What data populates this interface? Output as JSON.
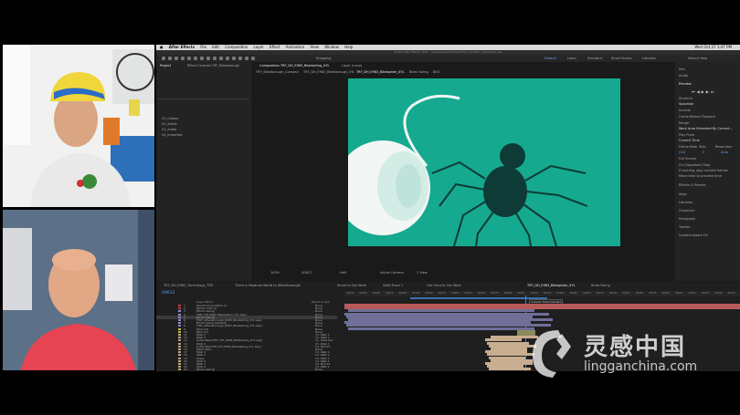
{
  "menubar": {
    "app": "After Effects",
    "items": [
      "File",
      "Edit",
      "Composition",
      "Layer",
      "Effect",
      "Animation",
      "View",
      "Window",
      "Help"
    ],
    "clock": "Wed Oct 27  1:47 PM"
  },
  "titlebar": {
    "title": "Adobe After Effects 2022 - /Users/Kaye/Dropbox/THV_Animation_Workshop.aep"
  },
  "toolbar": {
    "snapping": "Snapping",
    "workspaces": [
      "Default",
      "Learn",
      "Standard",
      "Small Screen",
      "Libraries"
    ],
    "search": "Search Help"
  },
  "project": {
    "tabs": [
      "Project",
      "Effect Controls TRF_Bikeborough"
    ],
    "files": [
      "01_Comps",
      "02_Solids",
      "03_Audio",
      "04_Imported"
    ]
  },
  "comp": {
    "header": "Composition TRF_DH_E983_Bikeballing_XYL",
    "layer_tab": "Layer (none)",
    "tabs": [
      "TRF_Bikeborough_Comped",
      "TRF_DH_E983_Bikeborough_XYL",
      "TRF_DH_E983_Bikespider_XYL",
      "Bikes Swing",
      "BKG"
    ],
    "footer": {
      "zoom": "100%",
      "time": "00612",
      "res": "Half",
      "camera": "Active Camera",
      "views": "1 View"
    }
  },
  "rightpanel": {
    "sections": [
      "Info",
      "Audio",
      "Preview",
      "Shortcut",
      "Include",
      "Cache Before Playback",
      "Range",
      "Work Area Extended By Current...",
      "Play From",
      "Current Time",
      "Frame Rate",
      "Skip",
      "Resolution",
      "Full Screen",
      "On (Spacebar) Stop",
      "If caching, play cached frames",
      "Move time to preview time",
      "Effects & Presets",
      "Align",
      "Libraries",
      "Character",
      "Paragraph",
      "Tracker",
      "Content-Aware Fill"
    ],
    "preview_values": {
      "shortcut": "Spacebar",
      "fps": "(24)",
      "skip": "0",
      "res": "Auto"
    }
  },
  "timeline": {
    "tabs": [
      "TRF_DH_E983_Technology_TRS",
      "There is Neptune World to Aftereborough",
      "Shoot to Get Work",
      "Solid Fixed 1",
      "Get Hurd to Get Work",
      "TRF_DH_E983_Bikespider_XYL",
      "Brida Swing"
    ],
    "timecode": "00612",
    "col_headers": {
      "name": "Layer Name",
      "parent": "Parent & Link"
    },
    "layers": [
      {
        "num": "1",
        "name": "[Solid Ground Wide 1]",
        "mode": "None",
        "color": "#c04040"
      },
      {
        "num": "2",
        "name": "[White Solid 1]",
        "mode": "None",
        "color": "#c04040"
      },
      {
        "num": "3",
        "name": "[Brida Swing]",
        "mode": "None",
        "color": "#8c8cd0"
      },
      {
        "num": "4",
        "name": "[TRF_DH_E983_Bikeballing_XYL.aep]",
        "mode": "None",
        "color": "#8c8cd0"
      },
      {
        "num": "5",
        "name": "[Brida Swing]",
        "mode": "None",
        "color": "#8c8cd0"
      },
      {
        "num": "6",
        "name": "[TRF_Aftereborough_E983_Bikeballing_XYL.aep]",
        "mode": "None",
        "color": "#8c8cd0"
      },
      {
        "num": "7",
        "name": "[Brida Swing Shadow]",
        "mode": "None",
        "color": "#8c8cd0"
      },
      {
        "num": "8",
        "name": "[TRF_Aftereborough_E983_Bikeballing_XYL.aep]",
        "mode": "None",
        "color": "#8c8cd0"
      },
      {
        "num": "9",
        "name": "[Null 10]",
        "mode": "None",
        "color": "#c0c040"
      },
      {
        "num": "10",
        "name": "[Null 11]",
        "mode": "None",
        "color": "#c0c040"
      },
      {
        "num": "11",
        "name": "Walk 4",
        "mode": "13. Walk 1",
        "color": "#c0a080"
      },
      {
        "num": "12",
        "name": "Walk 3",
        "mode": "13. Walk 1",
        "color": "#c0a080"
      },
      {
        "num": "13",
        "name": "[Little Bikes/TRF_DH_E983_Bikeballing_XYL.aep]",
        "mode": "11. Little Swi",
        "color": "#c0a080"
      },
      {
        "num": "14",
        "name": "Walk 2",
        "mode": "13. Walk 1",
        "color": "#c0a080"
      },
      {
        "num": "15",
        "name": "[Little Bike/TRF_DH_E983_Bikeballing_XYL.aep]",
        "mode": "14. Null 12",
        "color": "#c0a080"
      },
      {
        "num": "16",
        "name": "[Web Web]",
        "mode": "None",
        "color": "#c0a080"
      },
      {
        "num": "17",
        "name": "Walk 1",
        "mode": "13. Walk 1",
        "color": "#c0a080"
      },
      {
        "num": "18",
        "name": "Walk 5",
        "mode": "13. Walk 1",
        "color": "#c0a080"
      },
      {
        "num": "19",
        "name": "Glaze",
        "mode": "13. Walk 1",
        "color": "#c0a080"
      },
      {
        "num": "20",
        "name": "Walk 6",
        "mode": "13. Walk 1",
        "color": "#c0a080"
      },
      {
        "num": "21",
        "name": "Walk 7",
        "mode": "14. Null 12",
        "color": "#c0a080"
      },
      {
        "num": "22",
        "name": "Walk 9",
        "mode": "13. Walk 1",
        "color": "#c0a080"
      },
      {
        "num": "23",
        "name": "[Bikes Swing]",
        "mode": "None",
        "color": "#c0a080"
      }
    ],
    "ruler": [
      "00000",
      "00025",
      "00050",
      "00075",
      "00100",
      "00125",
      "00150",
      "00175",
      "00200",
      "00225",
      "00250",
      "00275",
      "00300",
      "00325",
      "00350",
      "00375",
      "00400",
      "00425",
      "00450",
      "00475",
      "00500",
      "00525",
      "00550",
      "00575",
      "00600",
      "00625",
      "00650",
      "00675",
      "00700",
      "00725"
    ],
    "marker": "Current Time Indicator"
  },
  "watermark": {
    "cn": "灵感中国",
    "en": "lingganchina.com"
  },
  "colors": {
    "viewer_bg": "#15a98f",
    "spider": "#0e3b35",
    "accent": "#2d8ceb"
  }
}
